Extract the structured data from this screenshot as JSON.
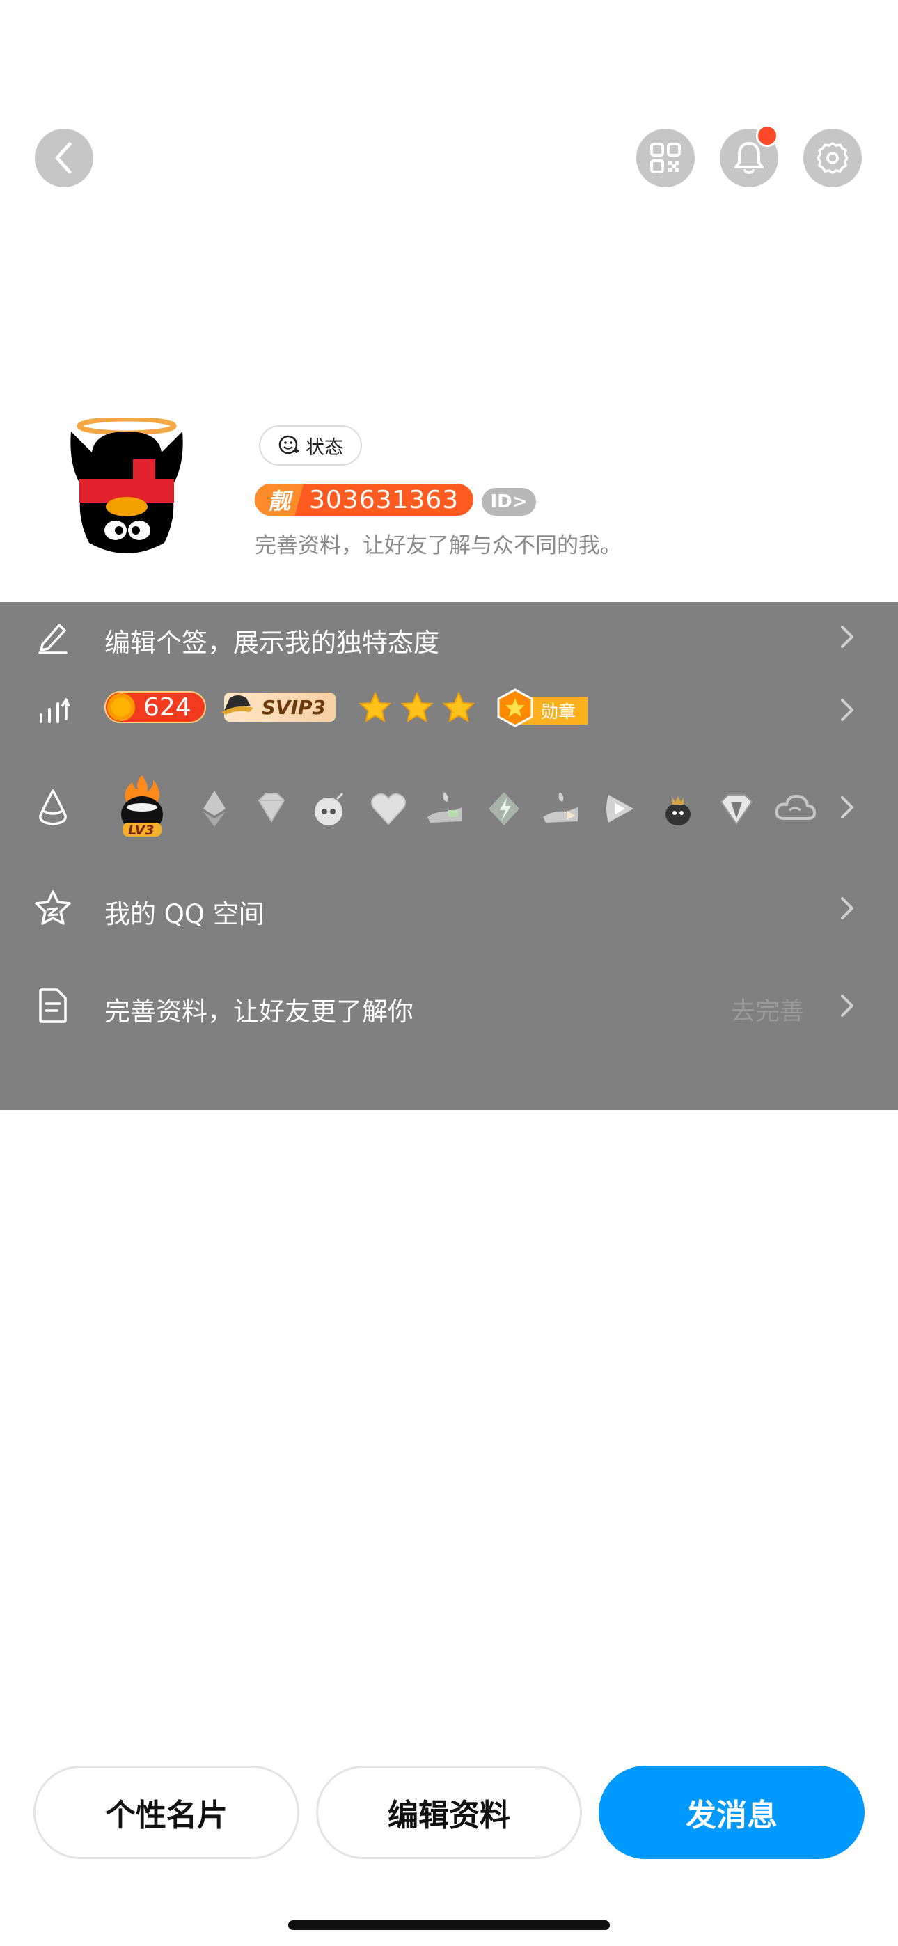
{
  "top_bar": {
    "back_icon": "chevron-left-icon",
    "qr_icon": "qr-code-icon",
    "bell_icon": "bell-icon",
    "settings_icon": "gear-icon",
    "bell_has_notification": true
  },
  "profile": {
    "status_label": "状态",
    "liang_label": "靓",
    "qq_number": "303631363",
    "id_chip": "ID>",
    "intro_text": "完善资料，让好友了解与众不同的我。"
  },
  "panel": {
    "signature_row": {
      "label": "编辑个签，展示我的独特态度"
    },
    "level_row": {
      "coins": "624",
      "svip_label": "SVIP3",
      "stars": 3,
      "medal_label": "勋章"
    },
    "badges_row": {
      "first_badge_label": "LV3",
      "badge_icons": [
        "lv3-flame-badge-icon",
        "ethereum-badge-icon",
        "diamond-badge-icon",
        "bomb-badge-icon",
        "heart-badge-icon",
        "gift-hand-badge-icon",
        "lightning-badge-icon",
        "hand-badge-icon",
        "play-badge-icon",
        "penguin-badge-icon",
        "gem-badge-icon",
        "cloud-badge-icon"
      ]
    },
    "qzone_row": {
      "label": "我的 QQ 空间"
    },
    "complete_row": {
      "label": "完善资料，让好友更了解你",
      "action": "去完善"
    }
  },
  "bottom": {
    "card_button": "个性名片",
    "edit_button": "编辑资料",
    "message_button": "发消息"
  },
  "colors": {
    "panel_gray": "#808080",
    "primary_blue": "#0099ff",
    "badge_orange": "#ff5a1f",
    "notification_red": "#ff4a2a"
  }
}
